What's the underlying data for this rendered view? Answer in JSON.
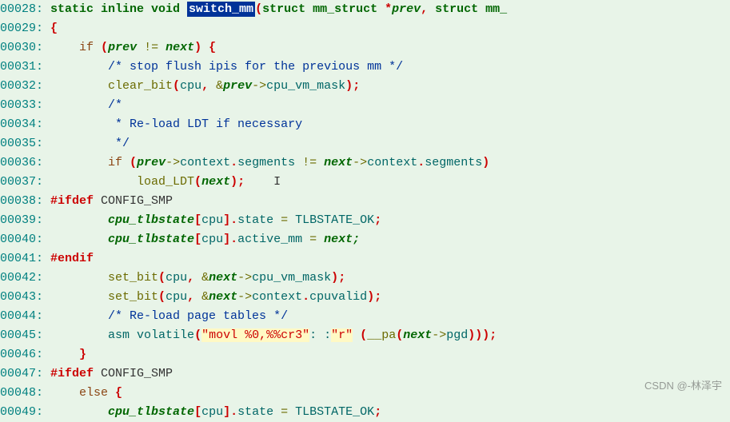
{
  "watermark": "CSDN @-林泽宇",
  "lines": {
    "l28": {
      "no": "00028: ",
      "t1": "static inline void ",
      "fn": "switch_mm",
      "t2": "(",
      "t3": "struct ",
      "t4": "mm_struct ",
      "t5": "*",
      "t6": "prev",
      "t7": ", ",
      "t8": "struct ",
      "t9": "mm_"
    },
    "l29": {
      "no": "00029: ",
      "b": "{"
    },
    "l30": {
      "no": "00030:     ",
      "kw": "if ",
      "p1": "(",
      "v1": "prev ",
      "op": "!= ",
      "v2": "next",
      "p2": ") ",
      "b": "{"
    },
    "l31": {
      "no": "00031:         ",
      "c": "/* stop flush ipis for the previous mm */"
    },
    "l32": {
      "no": "00032:         ",
      "fn": "clear_bit",
      "p1": "(",
      "a1": "cpu",
      "c1": ", ",
      "amp": "&",
      "v": "prev",
      "ar": "->",
      "m": "cpu_vm_mask",
      "p2": ")",
      "sc": ";"
    },
    "l33": {
      "no": "00033:         ",
      "c": "/*"
    },
    "l34": {
      "no": "00034:         ",
      "c": " * Re-load LDT if necessary"
    },
    "l35": {
      "no": "00035:         ",
      "c": " */"
    },
    "l36": {
      "no": "00036:         ",
      "kw": "if ",
      "p1": "(",
      "v1": "prev",
      "ar1": "->",
      "m1": "context",
      "d1": ".",
      "m2": "segments ",
      "op": "!= ",
      "v2": "next",
      "ar2": "->",
      "m3": "context",
      "d2": ".",
      "m4": "segments",
      "p2": ")"
    },
    "l37": {
      "no": "00037:             ",
      "fn": "load_LDT",
      "p1": "(",
      "v": "next",
      "p2": ")",
      "sc": ";",
      "cur": "    I"
    },
    "l38": {
      "no": "00038: ",
      "pp": "#ifdef ",
      "mac": "CONFIG_SMP"
    },
    "l39": {
      "no": "00039:         ",
      "v": "cpu_tlbstate",
      "br1": "[",
      "a": "cpu",
      "br2": "]",
      "d": ".",
      "m": "state ",
      "eq": "= ",
      "val": "TLBSTATE_OK",
      "sc": ";"
    },
    "l40": {
      "no": "00040:         ",
      "v": "cpu_tlbstate",
      "br1": "[",
      "a": "cpu",
      "br2": "]",
      "d": ".",
      "m": "active_mm ",
      "eq": "= ",
      "val": "next;"
    },
    "l41": {
      "no": "00041: ",
      "pp": "#endif"
    },
    "l42": {
      "no": "00042:         ",
      "fn": "set_bit",
      "p1": "(",
      "a1": "cpu",
      "c1": ", ",
      "amp": "&",
      "v": "next",
      "ar": "->",
      "m": "cpu_vm_mask",
      "p2": ")",
      "sc": ";"
    },
    "l43": {
      "no": "00043:         ",
      "fn": "set_bit",
      "p1": "(",
      "a1": "cpu",
      "c1": ", ",
      "amp": "&",
      "v": "next",
      "ar": "->",
      "m1": "context",
      "d": ".",
      "m2": "cpuvalid",
      "p2": ")",
      "sc": ";"
    },
    "l44": {
      "no": "00044:         ",
      "c": "/* Re-load page tables */"
    },
    "l45": {
      "no": "00045:         ",
      "t1": "asm volatile",
      "p1": "(",
      "s1": "\"movl %0,%%cr3\"",
      "col1": ": ",
      "col2": ":",
      "s2": "\"r\"",
      "sp": " ",
      "p2": "(",
      "fn": "__pa",
      "p3": "(",
      "v": "next",
      "ar": "->",
      "m": "pgd",
      "p4": ")))",
      "sc": ";"
    },
    "l46": {
      "no": "00046:     ",
      "b": "}"
    },
    "l47": {
      "no": "00047: ",
      "pp": "#ifdef ",
      "mac": "CONFIG_SMP"
    },
    "l48": {
      "no": "00048:     ",
      "kw": "else ",
      "b": "{"
    },
    "l49": {
      "no": "00049:         ",
      "v": "cpu_tlbstate",
      "br1": "[",
      "a": "cpu",
      "br2": "]",
      "d": ".",
      "m": "state ",
      "eq": "= ",
      "val": "TLBSTATE_OK",
      "sc": ";"
    }
  }
}
